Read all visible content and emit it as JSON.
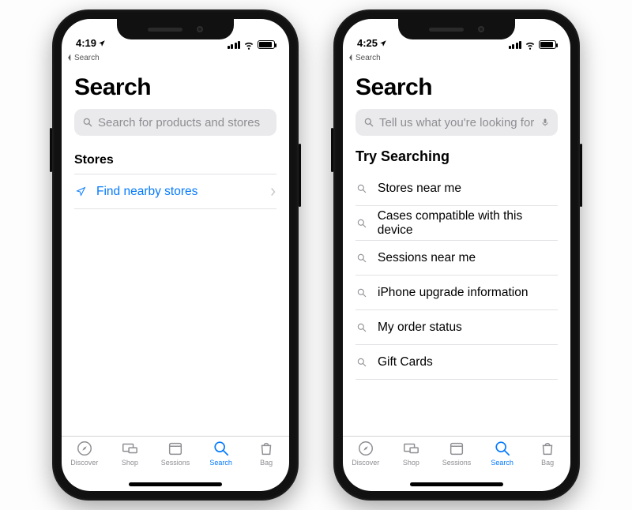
{
  "phoneA": {
    "status": {
      "time": "4:19",
      "back_label": "Search"
    },
    "title": "Search",
    "search": {
      "placeholder": "Search for products and stores"
    },
    "section_heading": "Stores",
    "link_row": {
      "label": "Find nearby stores"
    }
  },
  "phoneB": {
    "status": {
      "time": "4:25",
      "back_label": "Search"
    },
    "title": "Search",
    "search": {
      "placeholder": "Tell us what you're looking for"
    },
    "section_heading": "Try Searching",
    "suggestions": [
      "Stores near me",
      "Cases compatible with this device",
      "Sessions near me",
      "iPhone upgrade information",
      "My order status",
      "Gift Cards"
    ]
  },
  "tabs": [
    {
      "label": "Discover"
    },
    {
      "label": "Shop"
    },
    {
      "label": "Sessions"
    },
    {
      "label": "Search"
    },
    {
      "label": "Bag"
    }
  ],
  "colors": {
    "accent": "#057afe"
  }
}
